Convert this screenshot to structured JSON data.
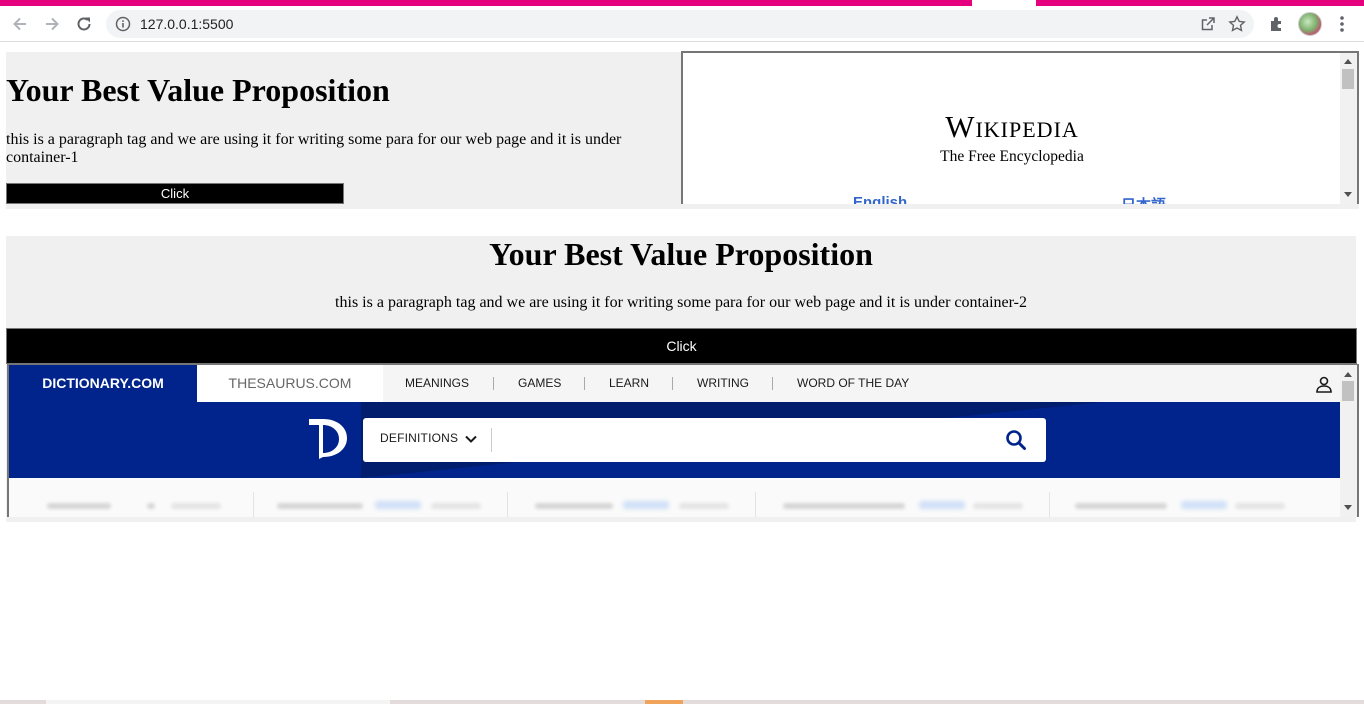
{
  "browser": {
    "url": "127.0.0.1:5500",
    "accent_color": "#e5007e"
  },
  "container1": {
    "title": "Your Best Value Proposition",
    "paragraph": "this is a paragraph tag and we are using it for writing some para for our web page and it is under container-1",
    "button_label": "Click"
  },
  "wikipedia": {
    "logo": "Wikipedia",
    "tagline": "The Free Encyclopedia",
    "languages": [
      "English",
      "日本語"
    ],
    "link_color": "#3366cc"
  },
  "container2": {
    "title": "Your Best Value Proposition",
    "paragraph": "this is a paragraph tag and we are using it for writing some para for our web page and it is under container-2",
    "button_label": "Click"
  },
  "dictionary": {
    "tabs": [
      "DICTIONARY.COM",
      "THESAURUS.COM"
    ],
    "nav": [
      "MEANINGS",
      "GAMES",
      "LEARN",
      "WRITING",
      "WORD OF THE DAY"
    ],
    "search_dropdown": "DEFINITIONS",
    "brand_color": "#00248b"
  },
  "icons": [
    "back-icon",
    "forward-icon",
    "reload-icon",
    "info-icon",
    "share-icon",
    "star-icon",
    "extensions-icon",
    "profile-avatar",
    "menu-icon",
    "user-icon",
    "search-icon",
    "chevron-down-icon"
  ]
}
